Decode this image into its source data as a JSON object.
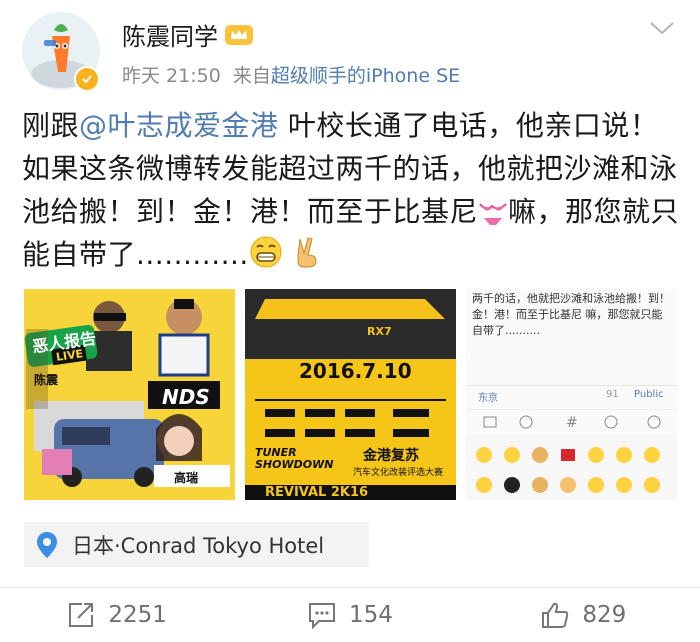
{
  "header": {
    "username": "陈震同学",
    "time": "昨天 21:50",
    "source_prefix": "来自",
    "source_device": "超级顺手的iPhone SE"
  },
  "post": {
    "t1": "刚跟",
    "mention": "@叶志成爱金港",
    "t2": " 叶校长通了电话，他亲口说！如果这条微博转发能超过两千的话，他就把沙滩和泳池给搬！到！金！港！而至于比基尼",
    "t3": "嘛，那您就只能自带了............"
  },
  "images": {
    "img1": {
      "show_title": "恶人报告",
      "show_sub": "LIVE",
      "badge": "NDS",
      "name1": "陈震",
      "name2": "高瑞"
    },
    "img2": {
      "date": "2016.7.10",
      "car_model": "RX7",
      "tuner": "TUNER SHOWDOWN",
      "event_cn": "金港复苏",
      "event_sub": "汽车文化改装评选大赛",
      "revival": "REVIVAL 2K16"
    },
    "img3": {
      "text": "两千的话，他就把沙滩和泳池给搬！到！金！港！而至于比基尼 嘛，那您就只能自带了..........",
      "loc": "东京",
      "count": "91",
      "public": "Public"
    }
  },
  "location": {
    "text": "日本·Conrad Tokyo Hotel"
  },
  "actions": {
    "repost_count": "2251",
    "comment_count": "154",
    "like_count": "829"
  },
  "colors": {
    "link": "#507daf",
    "muted": "#8a8a8a",
    "gold": "#f7b21d",
    "poster_yellow": "#f6d43a"
  }
}
